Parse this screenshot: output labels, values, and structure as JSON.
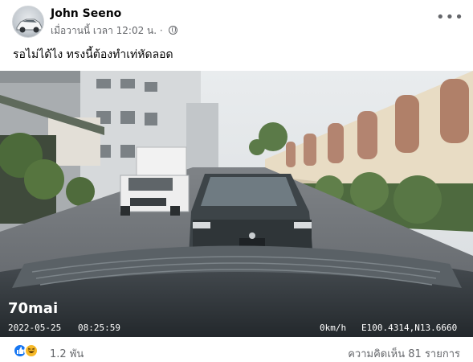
{
  "post": {
    "author": "John Seeno",
    "time": "เมื่อวานนี้ เวลา 12:02 น. ·",
    "privacy_icon": "globe-icon",
    "more_icon": "more-options-icon",
    "caption": "รอไม่ได้ไง ทรงนี้ต้องทำเท่หัดลอด"
  },
  "video": {
    "brand": "70mai",
    "date": "2022-05-25",
    "time": "08:25:59",
    "speed": "0km/h",
    "coords": "E100.4314,N13.6660"
  },
  "footer": {
    "reaction_icons": [
      "like-icon",
      "haha-icon"
    ],
    "reaction_count": "1.2 พัน",
    "comments": "ความคิดเห็น 81 รายการ"
  },
  "colors": {
    "like": "#1877f2",
    "haha": "#f7b928",
    "secondary_text": "#65676b"
  }
}
